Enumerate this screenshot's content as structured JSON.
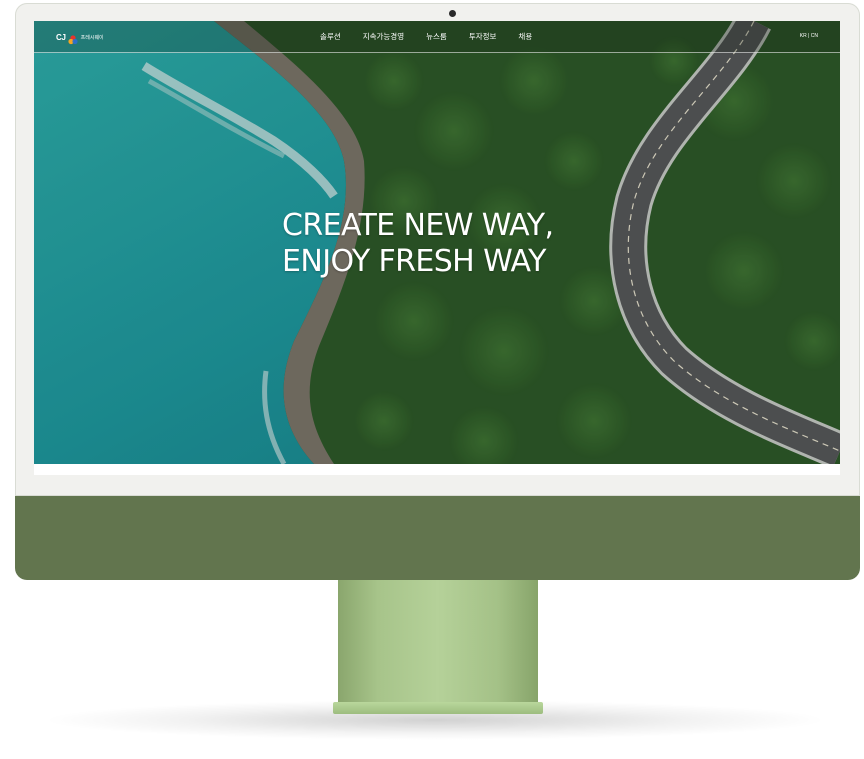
{
  "brand": {
    "logo_text": "CJ",
    "logo_subtext": "프레시웨이"
  },
  "nav": {
    "items": [
      {
        "label": "솔루션"
      },
      {
        "label": "지속가능경영"
      },
      {
        "label": "뉴스룸"
      },
      {
        "label": "투자정보"
      },
      {
        "label": "채용"
      }
    ],
    "lang": "KR | CN"
  },
  "hero": {
    "line1": "CREATE NEW WAY,",
    "line2": "ENJOY FRESH WAY"
  },
  "colors": {
    "device": "#62754e",
    "stand": "#a7c48a",
    "sea": "#1f9aa0",
    "forest": "#2f5f2c"
  }
}
